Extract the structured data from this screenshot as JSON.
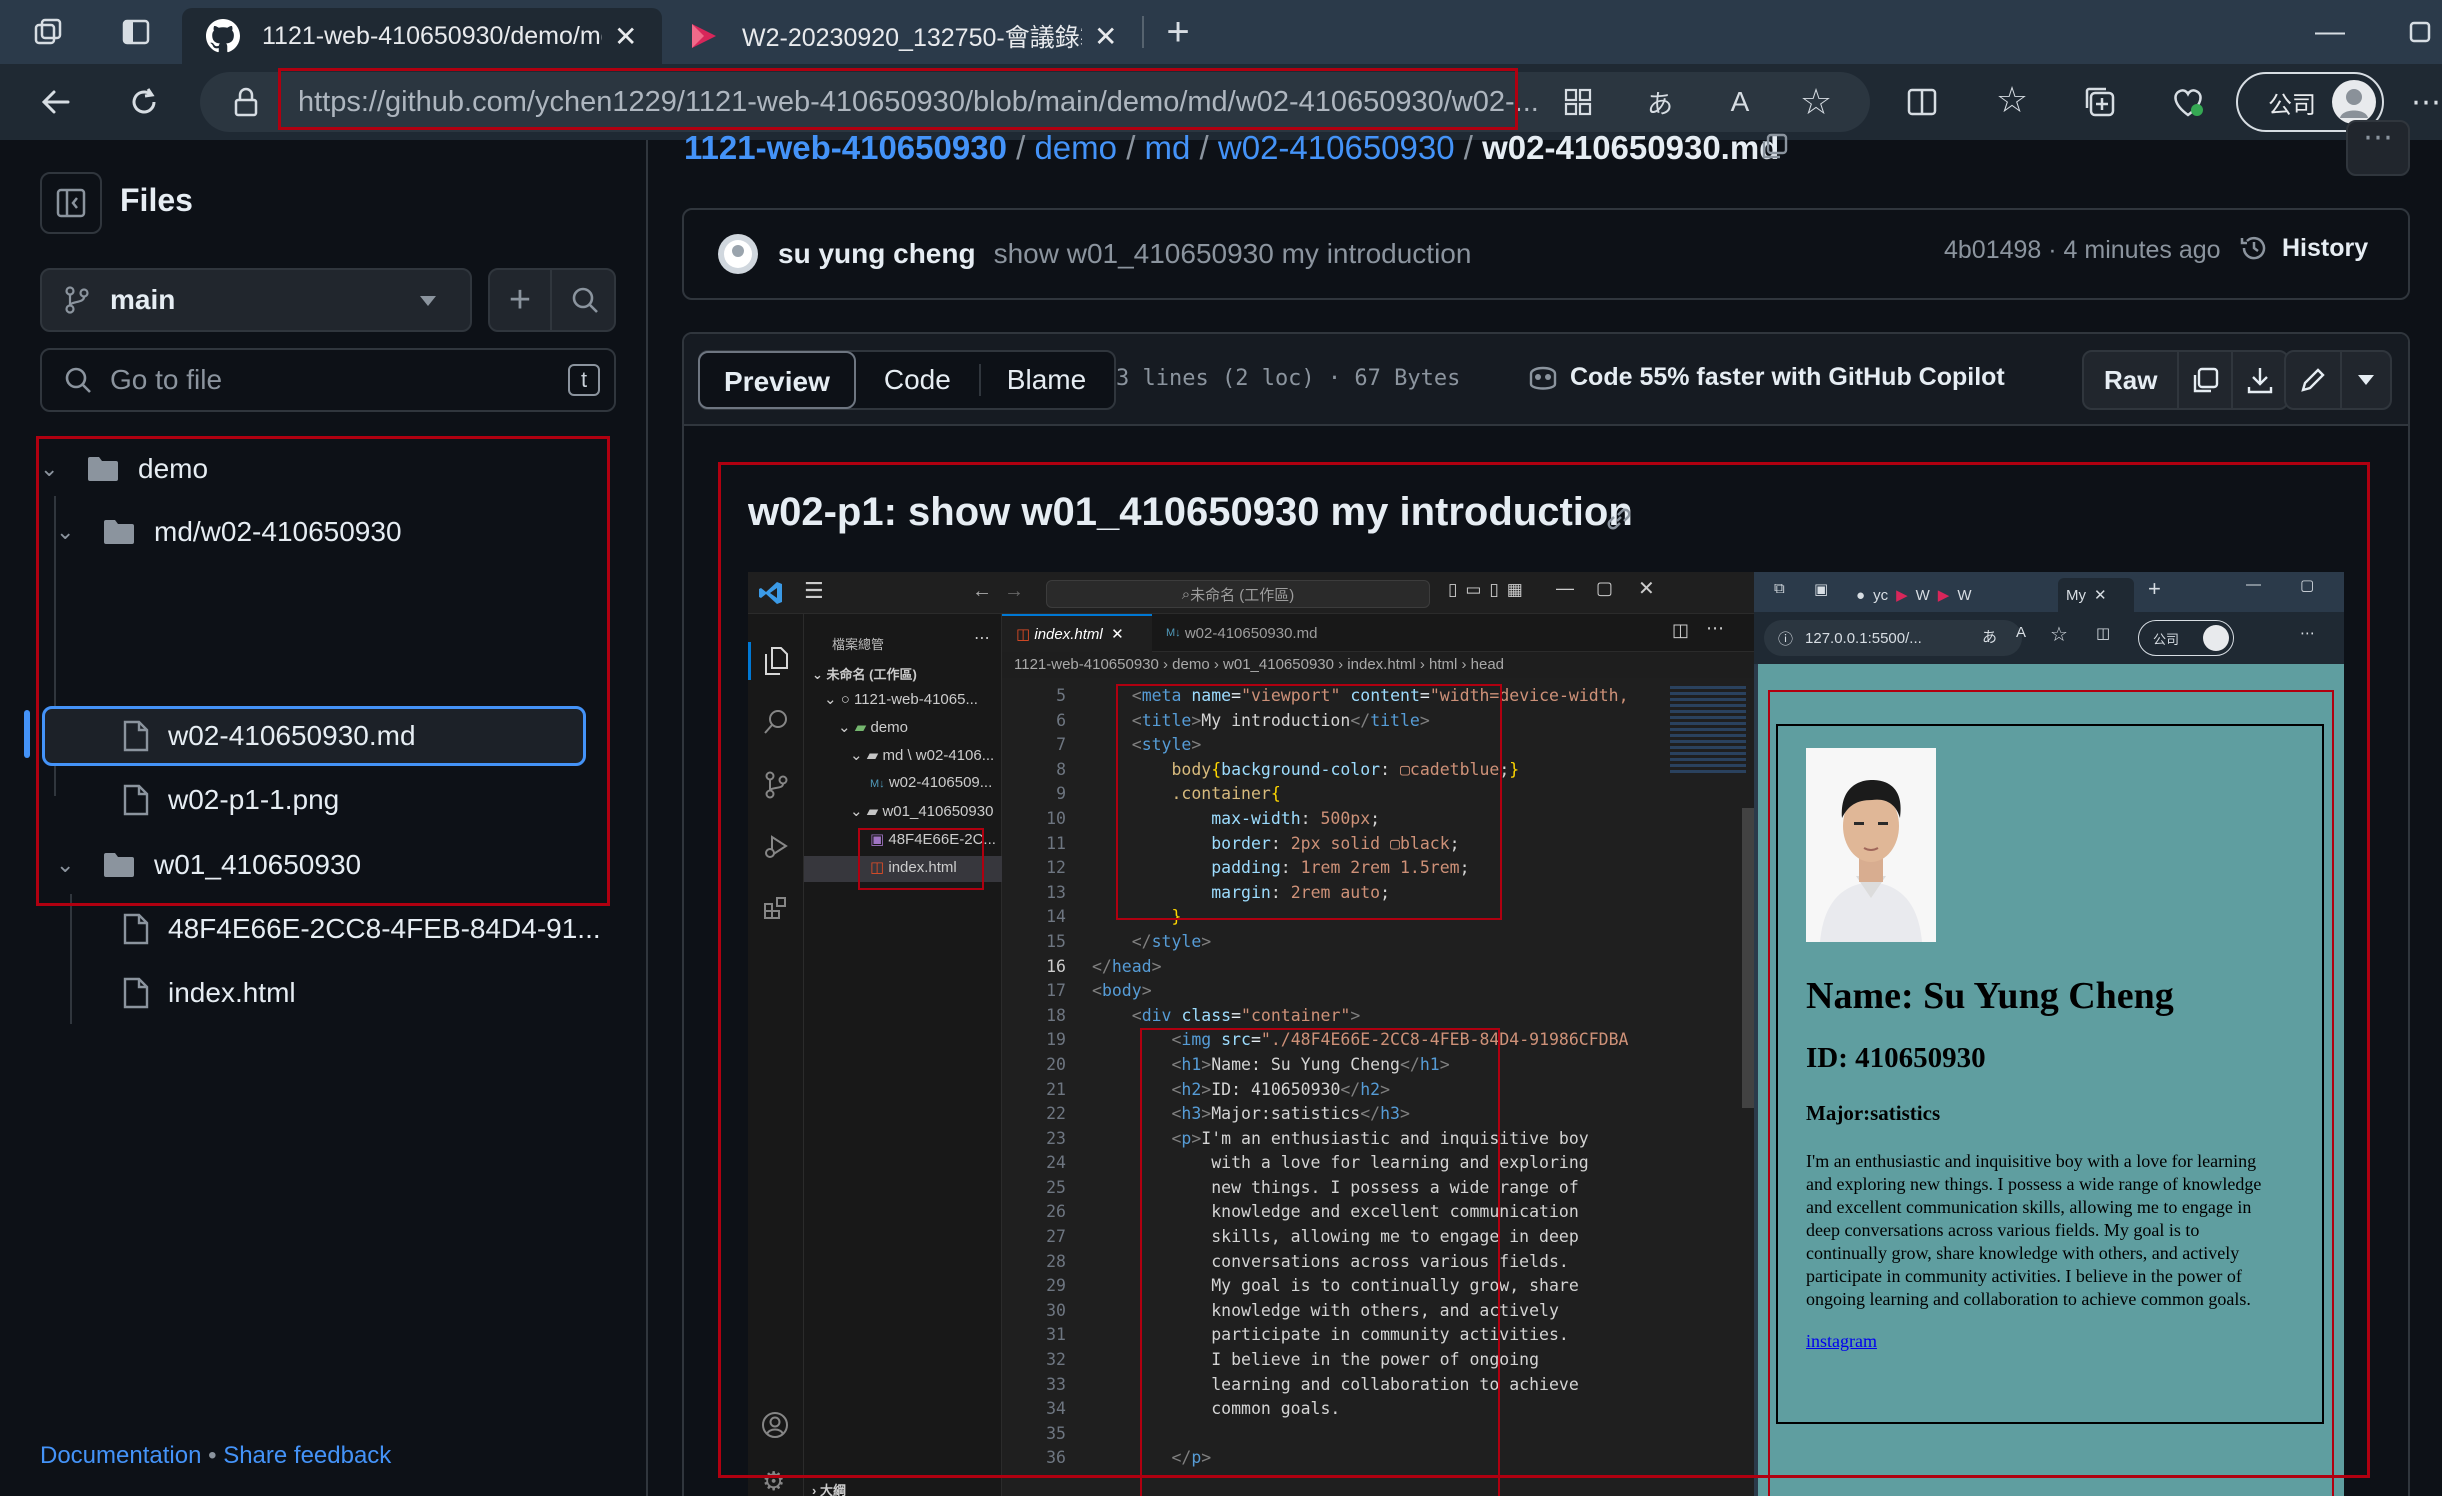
{
  "browser": {
    "tabs": [
      {
        "title": "1121-web-410650930/demo/md"
      },
      {
        "title": "W2-20230920_132750-會議錄製"
      }
    ],
    "url": "https://github.com/ychen1229/1121-web-410650930/blob/main/demo/md/w02-410650930/w02-...",
    "url_host": "github.com",
    "profile_label": "公司"
  },
  "sidebar": {
    "title": "Files",
    "branch": "main",
    "search_placeholder": "Go to file",
    "search_shortcut": "t",
    "tree": [
      {
        "label": "demo",
        "type": "folder"
      },
      {
        "label": "md/w02-410650930",
        "type": "folder"
      },
      {
        "label": "w02-410650930.md",
        "type": "file",
        "selected": true
      },
      {
        "label": "w02-p1-1.png",
        "type": "file"
      },
      {
        "label": "w01_410650930",
        "type": "folder"
      },
      {
        "label": "48F4E66E-2CC8-4FEB-84D4-91...",
        "type": "file"
      },
      {
        "label": "index.html",
        "type": "file"
      }
    ],
    "footer_doc": "Documentation",
    "footer_sep": "•",
    "footer_feedback": "Share feedback"
  },
  "breadcrumb": {
    "repo": "1121-web-410650930",
    "sep": "/",
    "p1": "demo",
    "p2": "md",
    "p3": "w02-410650930",
    "file": "w02-410650930.md"
  },
  "commit": {
    "author": "su yung cheng",
    "message": "show w01_410650930 my introduction",
    "hash_time": "4b01498 · 4 minutes ago",
    "history": "History"
  },
  "file_toolbar": {
    "preview": "Preview",
    "code": "Code",
    "blame": "Blame",
    "info": "3 lines (2 loc) · 67 Bytes",
    "copilot": "Code 55% faster with GitHub Copilot",
    "raw": "Raw"
  },
  "content": {
    "heading": "w02-p1: show w01_410650930 my introduction"
  },
  "screenshot": {
    "vscode": {
      "search": "未命名 (工作區)",
      "explorer_title": "檔案總管",
      "workspace": "未命名 (工作區)",
      "tree": [
        "1121-web-41065...",
        "demo",
        "md \\ w02-4106...",
        "w02-4106509...",
        "w01_410650930",
        "48F4E66E-2C...",
        "index.html"
      ],
      "tabs": [
        "index.html",
        "w02-410650930.md"
      ],
      "breadcrumb": "1121-web-410650930 › demo › w01_410650930 › index.html › html › head",
      "outline": "大綱",
      "code": [
        {
          "n": "5",
          "h": "    <span class='p'>&lt;</span><span class='k'>meta</span> <span class='a'>name</span>=<span class='s'>\"viewport\"</span> <span class='a'>content</span>=<span class='s'>\"width=device-width,</span>"
        },
        {
          "n": "6",
          "h": "    <span class='p'>&lt;</span><span class='k'>title</span><span class='p'>&gt;</span><span class='t'>My introduction</span><span class='p'>&lt;/</span><span class='k'>title</span><span class='p'>&gt;</span>"
        },
        {
          "n": "7",
          "h": "    <span class='p'>&lt;</span><span class='k'>style</span><span class='p'>&gt;</span>"
        },
        {
          "n": "8",
          "h": "        <span class='c'>body</span><span class='y'>{</span><span class='a'>background-color</span><span class='t'>: </span><span class='s'>▢cadetblue</span><span class='t'>;</span><span class='y'>}</span>"
        },
        {
          "n": "9",
          "h": "        <span class='c'>.container</span><span class='y'>{</span>"
        },
        {
          "n": "10",
          "h": "            <span class='a'>max-width</span><span class='t'>: </span><span class='s'>500px</span><span class='t'>;</span>"
        },
        {
          "n": "11",
          "h": "            <span class='a'>border</span><span class='t'>: </span><span class='s'>2px solid ▢black</span><span class='t'>;</span>"
        },
        {
          "n": "12",
          "h": "            <span class='a'>padding</span><span class='t'>: </span><span class='s'>1rem 2rem 1.5rem</span><span class='t'>;</span>"
        },
        {
          "n": "13",
          "h": "            <span class='a'>margin</span><span class='t'>: </span><span class='s'>2rem auto</span><span class='t'>;</span>"
        },
        {
          "n": "14",
          "h": "        <span class='y'>}</span>"
        },
        {
          "n": "15",
          "h": "    <span class='p'>&lt;/</span><span class='k'>style</span><span class='p'>&gt;</span>"
        },
        {
          "n": "16",
          "h": "<span class='p'>&lt;/</span><span class='k'>head</span><span class='p'>&gt;</span>"
        },
        {
          "n": "17",
          "h": "<span class='p'>&lt;</span><span class='k'>body</span><span class='p'>&gt;</span>"
        },
        {
          "n": "18",
          "h": "    <span class='p'>&lt;</span><span class='k'>div</span> <span class='a'>class</span>=<span class='s'>\"container\"</span><span class='p'>&gt;</span>"
        },
        {
          "n": "19",
          "h": "        <span class='p'>&lt;</span><span class='k'>img</span> <span class='a'>src</span>=<span class='s'>\"./48F4E66E-2CC8-4FEB-84D4-91986CFDBA</span>"
        },
        {
          "n": "20",
          "h": "        <span class='p'>&lt;</span><span class='k'>h1</span><span class='p'>&gt;</span><span class='t'>Name: Su Yung Cheng</span><span class='p'>&lt;/</span><span class='k'>h1</span><span class='p'>&gt;</span>"
        },
        {
          "n": "21",
          "h": "        <span class='p'>&lt;</span><span class='k'>h2</span><span class='p'>&gt;</span><span class='t'>ID: 410650930</span><span class='p'>&lt;/</span><span class='k'>h2</span><span class='p'>&gt;</span>"
        },
        {
          "n": "22",
          "h": "        <span class='p'>&lt;</span><span class='k'>h3</span><span class='p'>&gt;</span><span class='t'>Major:satistics</span><span class='p'>&lt;/</span><span class='k'>h3</span><span class='p'>&gt;</span>"
        },
        {
          "n": "23",
          "h": "        <span class='p'>&lt;</span><span class='k'>p</span><span class='p'>&gt;</span><span class='t'>I'm an enthusiastic and inquisitive boy</span>"
        },
        {
          "n": "24",
          "h": "<span class='t'>            with a love for learning and exploring</span>"
        },
        {
          "n": "25",
          "h": "<span class='t'>            new things. I possess a wide range of</span>"
        },
        {
          "n": "26",
          "h": "<span class='t'>            knowledge and excellent communication</span>"
        },
        {
          "n": "27",
          "h": "<span class='t'>            skills, allowing me to engage in deep</span>"
        },
        {
          "n": "28",
          "h": "<span class='t'>            conversations across various fields.</span>"
        },
        {
          "n": "29",
          "h": "<span class='t'>            My goal is to continually grow, share</span>"
        },
        {
          "n": "30",
          "h": "<span class='t'>            knowledge with others, and actively</span>"
        },
        {
          "n": "31",
          "h": "<span class='t'>            participate in community activities.</span>"
        },
        {
          "n": "32",
          "h": "<span class='t'>            I believe in the power of ongoing</span>"
        },
        {
          "n": "33",
          "h": "<span class='t'>            learning and collaboration to achieve</span>"
        },
        {
          "n": "34",
          "h": "<span class='t'>            common goals.</span>"
        },
        {
          "n": "35",
          "h": ""
        },
        {
          "n": "36",
          "h": "        <span class='p'>&lt;/</span><span class='k'>p</span><span class='p'>&gt;</span>"
        }
      ]
    },
    "edge": {
      "tabs": [
        "yc",
        "W",
        "W",
        "My"
      ],
      "url": "127.0.0.1:5500/...",
      "profile": "公司"
    },
    "page": {
      "h1": "Name: Su Yung Cheng",
      "h2": "ID: 410650930",
      "h3": "Major:satistics",
      "p": "I'm an enthusiastic and inquisitive boy with a love for learning and exploring new things. I possess a wide range of knowledge and excellent communication skills, allowing me to engage in deep conversations across various fields. My goal is to continually grow, share knowledge with others, and actively participate in community activities. I believe in the power of ongoing learning and collaboration to achieve common goals.",
      "link": "instagram"
    }
  },
  "colors": {
    "accent": "#4493f8",
    "highlight_box": "#b00010",
    "cadetblue": "#5f9ea0"
  }
}
